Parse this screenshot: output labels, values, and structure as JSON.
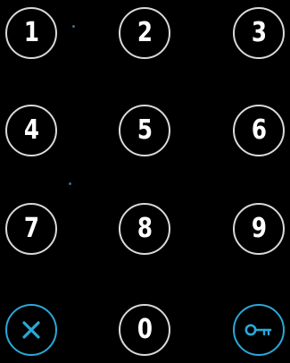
{
  "keypad": {
    "keys": [
      "1",
      "2",
      "3",
      "4",
      "5",
      "6",
      "7",
      "8",
      "9",
      "0"
    ],
    "clear_icon": "close-icon",
    "unlock_icon": "key-icon",
    "accent_color": "#2aa8d8",
    "ring_color": "#d9d9d9",
    "background": "#000000"
  }
}
